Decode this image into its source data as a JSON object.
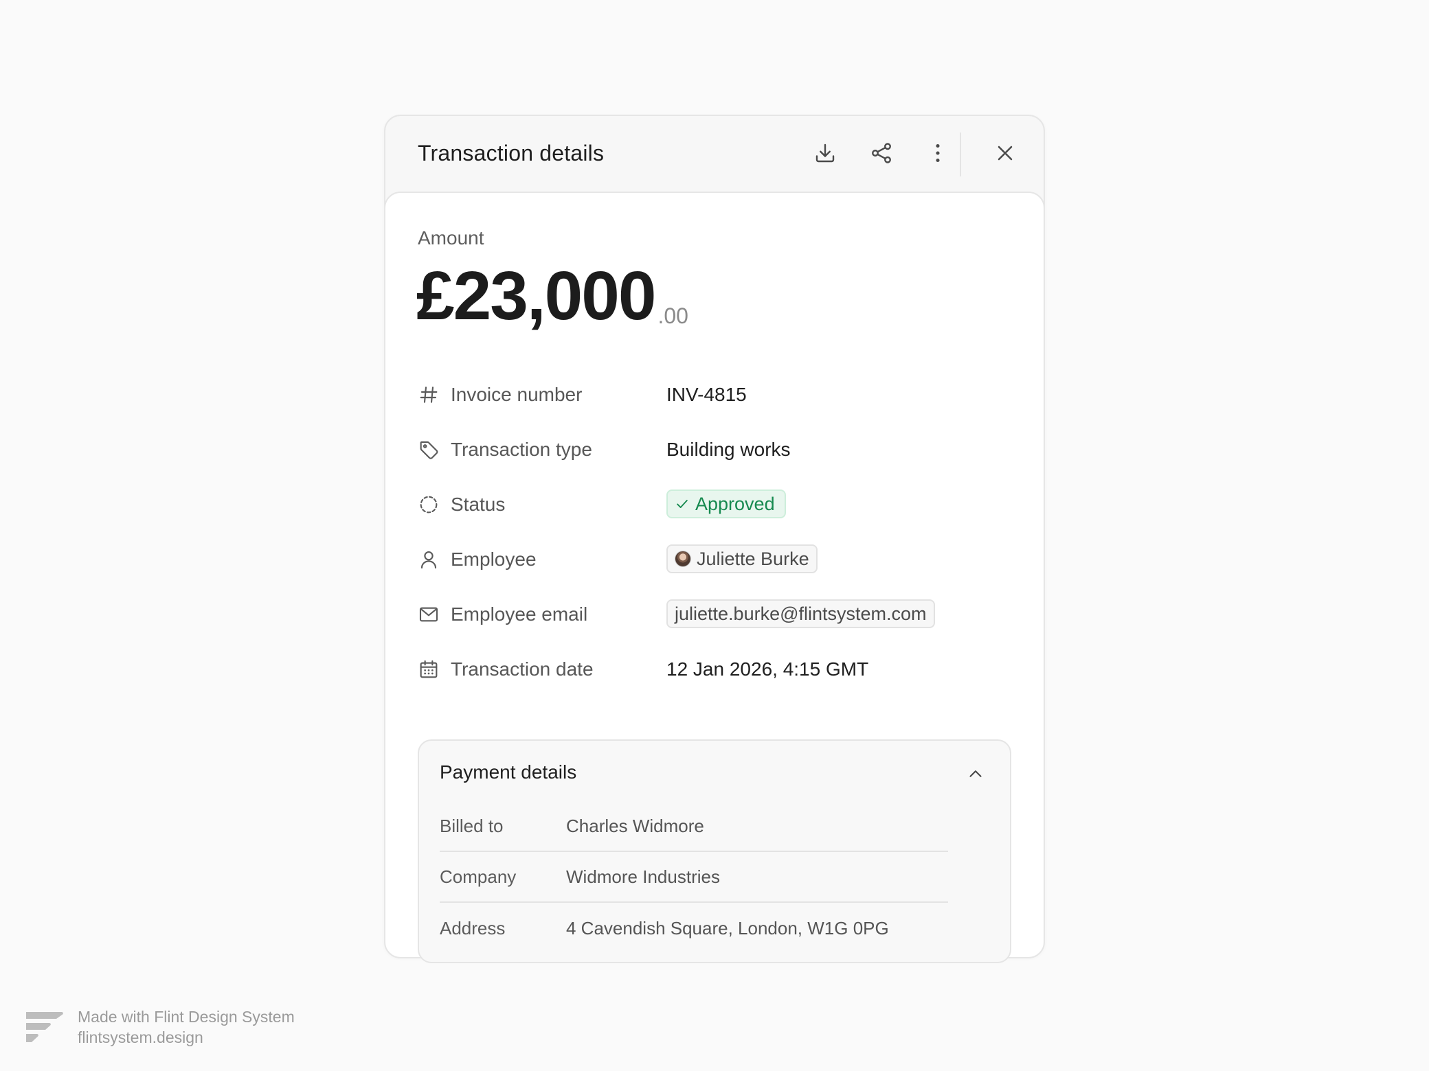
{
  "panel": {
    "title": "Transaction details",
    "actions": {
      "download_icon": "download-icon",
      "share_icon": "share-icon",
      "more_icon": "more-vertical-icon",
      "close_icon": "close-icon"
    }
  },
  "amount": {
    "label": "Amount",
    "value_main": "£23,000",
    "value_cents": ".00"
  },
  "fields": [
    {
      "icon": "hash-icon",
      "label": "Invoice number",
      "value": "INV-4815"
    },
    {
      "icon": "tag-icon",
      "label": "Transaction type",
      "value": "Building works"
    },
    {
      "icon": "status-dashed-circle-icon",
      "label": "Status",
      "value": "Approved"
    },
    {
      "icon": "user-icon",
      "label": "Employee",
      "value": "Juliette Burke"
    },
    {
      "icon": "mail-icon",
      "label": "Employee email",
      "value": "juliette.burke@flintsystem.com"
    },
    {
      "icon": "calendar-icon",
      "label": "Transaction date",
      "value": "12 Jan 2026, 4:15 GMT"
    }
  ],
  "status_colors": {
    "approved_text": "#178a50",
    "approved_bg": "#e8f6ee"
  },
  "payment_details": {
    "title": "Payment details",
    "expanded": true,
    "rows": [
      {
        "label": "Billed to",
        "value": "Charles Widmore"
      },
      {
        "label": "Company",
        "value": "Widmore Industries"
      },
      {
        "label": "Address",
        "value": "4 Cavendish Square, London, W1G 0PG"
      }
    ]
  },
  "footer": {
    "line1": "Made with Flint Design System",
    "line2": "flintsystem.design"
  }
}
